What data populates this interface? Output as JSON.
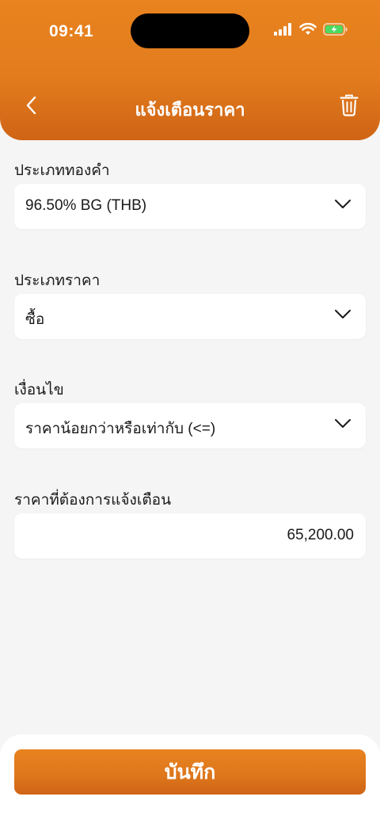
{
  "status_bar": {
    "time": "09:41",
    "icons": [
      "signal-icon",
      "wifi-icon",
      "battery-charging-icon"
    ],
    "battery_color": "#4cd964"
  },
  "header": {
    "title": "แจ้งเตือนราคา",
    "back_icon": "chevron-left-icon",
    "delete_icon": "trash-icon",
    "accent_color": "#e27c1d"
  },
  "form": {
    "gold_type": {
      "label": "ประเภททองคำ",
      "value": "96.50% BG (THB)"
    },
    "price_type": {
      "label": "ประเภทราคา",
      "value": "ซื้อ"
    },
    "condition": {
      "label": "เงื่อนไข",
      "value": "ราคาน้อยกว่าหรือเท่ากับ (<=)"
    },
    "target_price": {
      "label": "ราคาที่ต้องการแจ้งเตือน",
      "value": "65,200.00"
    }
  },
  "footer": {
    "save_label": "บันทึก"
  }
}
